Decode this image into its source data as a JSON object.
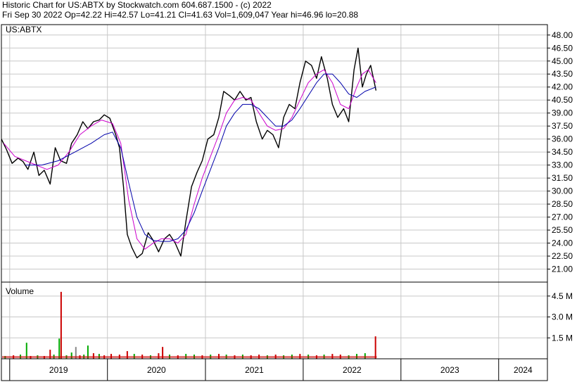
{
  "header": {
    "line1": "Historic Chart for US:ABTX by Stockwatch.com 604.687.1500 - (c) 2022",
    "line2": "Fri Sep 30 2022   Op=42.22  Hi=42.57  Lo=41.21  Cl=41.63  Vol=1,609,047   Year hi=46.96  lo=20.88"
  },
  "colors": {
    "price": "#000000",
    "ma_short": "#cc00cc",
    "ma_long": "#0000aa",
    "vol_up": "#00aa00",
    "vol_down": "#cc0000",
    "vol_neutral": "#888888",
    "grid": "#c8c8c8"
  },
  "chart_data": [
    {
      "type": "line",
      "symbol_label": "US:ABTX",
      "x_start": "2018-12",
      "x_end": "2024-07",
      "ylim": [
        19.5,
        49.2
      ],
      "y_ticks": [
        "48.00",
        "46.50",
        "45.00",
        "43.50",
        "42.00",
        "40.50",
        "39.00",
        "37.50",
        "36.00",
        "34.50",
        "33.00",
        "31.50",
        "30.00",
        "28.50",
        "27.00",
        "25.50",
        "24.00",
        "22.50",
        "21.00"
      ],
      "x_ticks": [
        "2019",
        "2020",
        "2021",
        "2022",
        "2023",
        "2024"
      ],
      "grid": true,
      "series": [
        {
          "role": "price",
          "points": [
            [
              "2018-12-01",
              36.0
            ],
            [
              "2018-12-20",
              34.8
            ],
            [
              "2019-01-10",
              33.2
            ],
            [
              "2019-02-01",
              33.8
            ],
            [
              "2019-02-20",
              33.4
            ],
            [
              "2019-03-10",
              32.5
            ],
            [
              "2019-04-01",
              34.5
            ],
            [
              "2019-04-20",
              31.8
            ],
            [
              "2019-05-10",
              32.4
            ],
            [
              "2019-06-01",
              30.8
            ],
            [
              "2019-06-20",
              35.0
            ],
            [
              "2019-07-10",
              33.5
            ],
            [
              "2019-08-01",
              33.2
            ],
            [
              "2019-08-20",
              35.5
            ],
            [
              "2019-09-10",
              36.5
            ],
            [
              "2019-10-01",
              38.0
            ],
            [
              "2019-10-20",
              37.2
            ],
            [
              "2019-11-10",
              38.0
            ],
            [
              "2019-12-01",
              38.2
            ],
            [
              "2019-12-20",
              38.8
            ],
            [
              "2020-01-10",
              38.4
            ],
            [
              "2020-02-01",
              36.5
            ],
            [
              "2020-02-15",
              35.0
            ],
            [
              "2020-03-01",
              30.5
            ],
            [
              "2020-03-15",
              25.0
            ],
            [
              "2020-04-01",
              23.5
            ],
            [
              "2020-04-20",
              22.3
            ],
            [
              "2020-05-10",
              22.8
            ],
            [
              "2020-06-01",
              25.2
            ],
            [
              "2020-06-20",
              24.3
            ],
            [
              "2020-07-10",
              23.0
            ],
            [
              "2020-08-01",
              24.5
            ],
            [
              "2020-08-20",
              25.0
            ],
            [
              "2020-09-10",
              24.0
            ],
            [
              "2020-10-01",
              22.5
            ],
            [
              "2020-10-20",
              26.5
            ],
            [
              "2020-11-10",
              30.5
            ],
            [
              "2020-12-01",
              32.2
            ],
            [
              "2020-12-20",
              33.5
            ],
            [
              "2021-01-10",
              36.0
            ],
            [
              "2021-02-01",
              36.5
            ],
            [
              "2021-02-20",
              38.5
            ],
            [
              "2021-03-10",
              41.5
            ],
            [
              "2021-04-01",
              41.0
            ],
            [
              "2021-04-20",
              40.5
            ],
            [
              "2021-05-10",
              41.5
            ],
            [
              "2021-06-01",
              40.5
            ],
            [
              "2021-06-20",
              40.8
            ],
            [
              "2021-07-10",
              38.0
            ],
            [
              "2021-08-01",
              36.0
            ],
            [
              "2021-08-20",
              37.0
            ],
            [
              "2021-09-10",
              36.5
            ],
            [
              "2021-10-01",
              35.0
            ],
            [
              "2021-10-20",
              38.5
            ],
            [
              "2021-11-10",
              40.0
            ],
            [
              "2021-12-01",
              39.5
            ],
            [
              "2021-12-20",
              42.5
            ],
            [
              "2022-01-10",
              45.0
            ],
            [
              "2022-02-01",
              44.5
            ],
            [
              "2022-02-20",
              43.0
            ],
            [
              "2022-03-10",
              45.5
            ],
            [
              "2022-04-01",
              43.0
            ],
            [
              "2022-04-20",
              40.0
            ],
            [
              "2022-05-10",
              38.5
            ],
            [
              "2022-06-01",
              39.5
            ],
            [
              "2022-06-20",
              38.0
            ],
            [
              "2022-07-10",
              44.0
            ],
            [
              "2022-07-25",
              46.5
            ],
            [
              "2022-08-10",
              42.0
            ],
            [
              "2022-08-25",
              43.5
            ],
            [
              "2022-09-10",
              44.5
            ],
            [
              "2022-09-30",
              41.6
            ]
          ]
        },
        {
          "role": "ma_short",
          "points": [
            [
              "2018-12-10",
              35.5
            ],
            [
              "2019-01-20",
              34.0
            ],
            [
              "2019-03-01",
              33.5
            ],
            [
              "2019-04-10",
              33.0
            ],
            [
              "2019-05-20",
              32.5
            ],
            [
              "2019-07-01",
              33.0
            ],
            [
              "2019-08-10",
              34.5
            ],
            [
              "2019-09-20",
              36.5
            ],
            [
              "2019-11-01",
              37.5
            ],
            [
              "2019-12-10",
              38.2
            ],
            [
              "2020-01-20",
              37.8
            ],
            [
              "2020-02-20",
              35.5
            ],
            [
              "2020-03-20",
              29.0
            ],
            [
              "2020-04-20",
              24.5
            ],
            [
              "2020-05-20",
              23.3
            ],
            [
              "2020-06-20",
              24.0
            ],
            [
              "2020-07-20",
              24.5
            ],
            [
              "2020-08-20",
              24.5
            ],
            [
              "2020-09-20",
              24.0
            ],
            [
              "2020-10-20",
              25.0
            ],
            [
              "2020-11-20",
              28.5
            ],
            [
              "2020-12-20",
              31.5
            ],
            [
              "2021-01-20",
              34.0
            ],
            [
              "2021-02-20",
              36.5
            ],
            [
              "2021-03-20",
              39.0
            ],
            [
              "2021-04-20",
              40.5
            ],
            [
              "2021-05-20",
              40.8
            ],
            [
              "2021-06-20",
              40.5
            ],
            [
              "2021-07-20",
              39.0
            ],
            [
              "2021-08-20",
              37.5
            ],
            [
              "2021-09-20",
              37.0
            ],
            [
              "2021-10-20",
              37.2
            ],
            [
              "2021-11-20",
              38.5
            ],
            [
              "2021-12-20",
              40.5
            ],
            [
              "2022-01-20",
              42.5
            ],
            [
              "2022-02-20",
              43.5
            ],
            [
              "2022-03-20",
              44.0
            ],
            [
              "2022-04-20",
              42.5
            ],
            [
              "2022-05-20",
              40.0
            ],
            [
              "2022-06-20",
              39.5
            ],
            [
              "2022-07-20",
              42.0
            ],
            [
              "2022-08-10",
              43.5
            ],
            [
              "2022-09-01",
              44.0
            ],
            [
              "2022-09-30",
              42.5
            ]
          ]
        },
        {
          "role": "ma_long",
          "points": [
            [
              "2019-03-01",
              33.0
            ],
            [
              "2019-05-01",
              33.0
            ],
            [
              "2019-07-01",
              33.5
            ],
            [
              "2019-09-01",
              34.5
            ],
            [
              "2019-11-01",
              35.5
            ],
            [
              "2019-12-20",
              36.5
            ],
            [
              "2020-01-20",
              36.8
            ],
            [
              "2020-02-20",
              35.0
            ],
            [
              "2020-03-20",
              31.0
            ],
            [
              "2020-04-20",
              27.0
            ],
            [
              "2020-05-20",
              25.0
            ],
            [
              "2020-06-20",
              24.3
            ],
            [
              "2020-07-20",
              24.2
            ],
            [
              "2020-08-20",
              24.2
            ],
            [
              "2020-09-20",
              24.5
            ],
            [
              "2020-10-20",
              25.5
            ],
            [
              "2020-11-20",
              27.5
            ],
            [
              "2020-12-20",
              30.0
            ],
            [
              "2021-01-20",
              32.5
            ],
            [
              "2021-02-20",
              35.0
            ],
            [
              "2021-03-20",
              37.5
            ],
            [
              "2021-04-20",
              39.0
            ],
            [
              "2021-05-20",
              40.0
            ],
            [
              "2021-06-20",
              40.0
            ],
            [
              "2021-07-20",
              39.5
            ],
            [
              "2021-08-20",
              38.5
            ],
            [
              "2021-09-20",
              37.5
            ],
            [
              "2021-10-20",
              37.5
            ],
            [
              "2021-11-20",
              38.2
            ],
            [
              "2021-12-20",
              39.5
            ],
            [
              "2022-01-20",
              41.0
            ],
            [
              "2022-02-20",
              42.5
            ],
            [
              "2022-03-20",
              43.5
            ],
            [
              "2022-04-20",
              43.5
            ],
            [
              "2022-05-20",
              42.5
            ],
            [
              "2022-06-20",
              41.2
            ],
            [
              "2022-07-20",
              40.8
            ],
            [
              "2022-08-20",
              41.5
            ],
            [
              "2022-09-30",
              42.0
            ]
          ]
        }
      ]
    },
    {
      "type": "bar",
      "title": "Volume",
      "y_ticks": [
        [
          "4.5 M",
          4500000
        ],
        [
          "3.0 M",
          3000000
        ],
        [
          "1.5 M",
          1500000
        ]
      ],
      "ylim": [
        0,
        5500000
      ],
      "bars": [
        [
          "2018-12-15",
          200000,
          "up"
        ],
        [
          "2019-01-15",
          250000,
          "down"
        ],
        [
          "2019-02-10",
          300000,
          "up"
        ],
        [
          "2019-03-05",
          1150000,
          "up"
        ],
        [
          "2019-03-20",
          200000,
          "down"
        ],
        [
          "2019-04-15",
          250000,
          "up"
        ],
        [
          "2019-05-10",
          200000,
          "down"
        ],
        [
          "2019-06-01",
          650000,
          "down"
        ],
        [
          "2019-06-15",
          300000,
          "up"
        ],
        [
          "2019-07-05",
          1450000,
          "up"
        ],
        [
          "2019-07-12",
          4800000,
          "down"
        ],
        [
          "2019-08-01",
          250000,
          "up"
        ],
        [
          "2019-08-20",
          450000,
          "up"
        ],
        [
          "2019-09-05",
          850000,
          "neutral"
        ],
        [
          "2019-09-20",
          250000,
          "down"
        ],
        [
          "2019-10-05",
          300000,
          "up"
        ],
        [
          "2019-10-20",
          950000,
          "up"
        ],
        [
          "2019-11-10",
          400000,
          "down"
        ],
        [
          "2019-12-01",
          350000,
          "up"
        ],
        [
          "2019-12-20",
          250000,
          "down"
        ],
        [
          "2020-01-15",
          350000,
          "down"
        ],
        [
          "2020-02-15",
          300000,
          "down"
        ],
        [
          "2020-03-15",
          550000,
          "down"
        ],
        [
          "2020-04-10",
          350000,
          "up"
        ],
        [
          "2020-05-10",
          300000,
          "down"
        ],
        [
          "2020-06-10",
          250000,
          "up"
        ],
        [
          "2020-07-10",
          400000,
          "down"
        ],
        [
          "2020-07-25",
          850000,
          "down"
        ],
        [
          "2020-08-20",
          300000,
          "up"
        ],
        [
          "2020-09-20",
          250000,
          "down"
        ],
        [
          "2020-10-20",
          350000,
          "up"
        ],
        [
          "2020-11-20",
          300000,
          "up"
        ],
        [
          "2020-12-20",
          250000,
          "down"
        ],
        [
          "2021-01-20",
          300000,
          "up"
        ],
        [
          "2021-02-20",
          350000,
          "down"
        ],
        [
          "2021-03-20",
          300000,
          "up"
        ],
        [
          "2021-04-20",
          250000,
          "down"
        ],
        [
          "2021-05-20",
          300000,
          "up"
        ],
        [
          "2021-06-20",
          250000,
          "down"
        ],
        [
          "2021-07-20",
          300000,
          "down"
        ],
        [
          "2021-08-20",
          250000,
          "up"
        ],
        [
          "2021-09-20",
          300000,
          "down"
        ],
        [
          "2021-10-20",
          250000,
          "up"
        ],
        [
          "2021-11-20",
          300000,
          "up"
        ],
        [
          "2021-12-20",
          350000,
          "down"
        ],
        [
          "2022-01-20",
          300000,
          "up"
        ],
        [
          "2022-02-20",
          250000,
          "down"
        ],
        [
          "2022-03-20",
          300000,
          "up"
        ],
        [
          "2022-04-20",
          350000,
          "down"
        ],
        [
          "2022-05-20",
          300000,
          "down"
        ],
        [
          "2022-06-20",
          250000,
          "up"
        ],
        [
          "2022-07-20",
          350000,
          "up"
        ],
        [
          "2022-08-20",
          400000,
          "up"
        ],
        [
          "2022-09-28",
          1609047,
          "down"
        ]
      ]
    }
  ]
}
